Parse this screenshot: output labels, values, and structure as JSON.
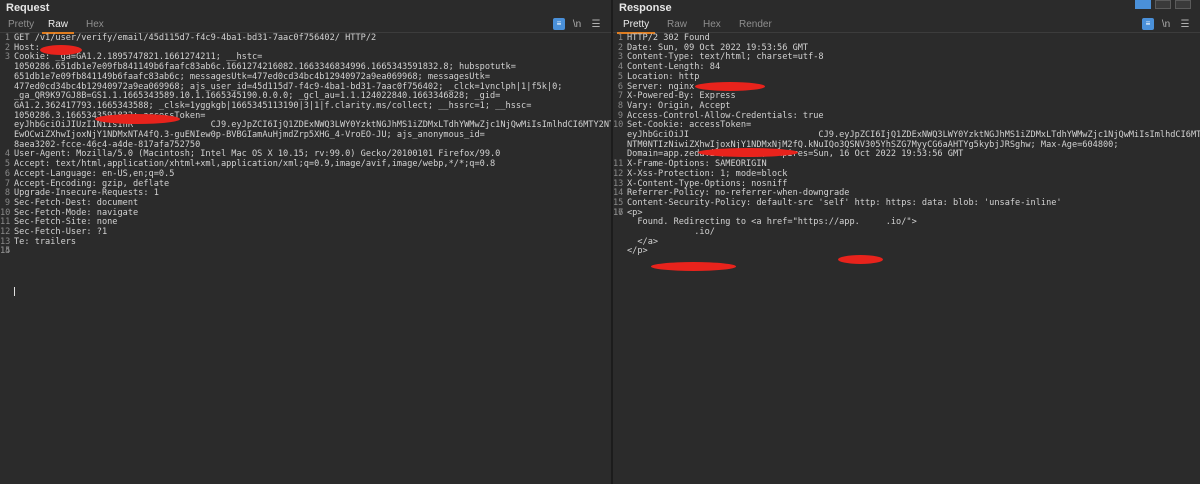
{
  "request": {
    "title": "Request",
    "tabs": [
      "Pretty",
      "Raw",
      "Hex"
    ],
    "active_tab": "Raw",
    "newline_btn": "\\n",
    "lines": [
      {
        "n": "1",
        "text": [
          "GET /v1/user/verify/email/45d115d7-f4c9-4ba1-bd31-7aac0f756402/ HTTP/2"
        ]
      },
      {
        "n": "2",
        "text": [
          "Host: "
        ]
      },
      {
        "n": "3",
        "text": [
          "Cookie: _ga=GA1.2.1895747821.1661274211; __hstc=",
          "1050286.651db1e7e09fb841149b6faafc83ab6c.1661274216082.1663346834996.1665343591832.8; hubspotutk=",
          "651db1e7e09fb841149b6faafc83ab6c; messagesUtk=477ed0cd34bc4b12940972a9ea069968; messagesUtk=",
          "477ed0cd34bc4b12940972a9ea069968; ajs_user_id=45d115d7-f4c9-4ba1-bd31-7aac0f756402; _clck=1vnclph|1|f5k|0;",
          "_ga_QR9K97GJ8B=GS1.1.1665343589.10.1.1665345190.0.0.0; _gcl_au=1.1.124022840.1663346828; _gid=",
          "GA1.2.362417793.1665343588; _clsk=1yggkgb|1665345113190|3|1|f.clarity.ms/collect; __hssrc=1; __hssc=",
          "1050286.3.1665343591832; accessToken=",
          "eyJhbGciOiJIUzI1NiIsInR               CJ9.eyJpZCI6IjQ1ZDExNWQ3LWY0YzktNGJhMS1iZDMxLTdhYWMwZjc1NjQwMiIsImlhdCI6MTY2NTM0NT",
          "EwOCwiZXhwIjoxNjY1NDMxNTA4fQ.3-guENIew0p-BVBGIamAuHjmdZrp5XHG_4-VroEO-JU; ajs_anonymous_id=",
          "8aea3202-fcce-46c4-a4de-817afa752750"
        ]
      },
      {
        "n": "4",
        "text": [
          "User-Agent: Mozilla/5.0 (Macintosh; Intel Mac OS X 10.15; rv:99.0) Gecko/20100101 Firefox/99.0"
        ]
      },
      {
        "n": "5",
        "text": [
          "Accept: text/html,application/xhtml+xml,application/xml;q=0.9,image/avif,image/webp,*/*;q=0.8"
        ]
      },
      {
        "n": "6",
        "text": [
          "Accept-Language: en-US,en;q=0.5"
        ]
      },
      {
        "n": "7",
        "text": [
          "Accept-Encoding: gzip, deflate"
        ]
      },
      {
        "n": "8",
        "text": [
          "Upgrade-Insecure-Requests: 1"
        ]
      },
      {
        "n": "9",
        "text": [
          "Sec-Fetch-Dest: document"
        ]
      },
      {
        "n": "10",
        "text": [
          "Sec-Fetch-Mode: navigate"
        ]
      },
      {
        "n": "11",
        "text": [
          "Sec-Fetch-Site: none"
        ]
      },
      {
        "n": "12",
        "text": [
          "Sec-Fetch-User: ?1"
        ]
      },
      {
        "n": "13",
        "text": [
          "Te: trailers"
        ]
      },
      {
        "n": "14",
        "text": [
          ""
        ]
      },
      {
        "n": "15",
        "text": [
          ""
        ]
      }
    ]
  },
  "response": {
    "title": "Response",
    "tabs": [
      "Pretty",
      "Raw",
      "Hex",
      "Render"
    ],
    "active_tab": "Pretty",
    "newline_btn": "\\n",
    "lines": [
      {
        "n": "1",
        "text": [
          "HTTP/2 302 Found"
        ]
      },
      {
        "n": "2",
        "text": [
          "Date: Sun, 09 Oct 2022 19:53:56 GMT"
        ]
      },
      {
        "n": "3",
        "text": [
          "Content-Type: text/html; charset=utf-8"
        ]
      },
      {
        "n": "4",
        "text": [
          "Content-Length: 84"
        ]
      },
      {
        "n": "5",
        "text": [
          "Location: http"
        ]
      },
      {
        "n": "6",
        "text": [
          "Server: nginx"
        ]
      },
      {
        "n": "7",
        "text": [
          "X-Powered-By: Express"
        ]
      },
      {
        "n": "8",
        "text": [
          "Vary: Origin, Accept"
        ]
      },
      {
        "n": "9",
        "text": [
          "Access-Control-Allow-Credentials: true"
        ]
      },
      {
        "n": "10",
        "text": [
          "Set-Cookie: accessToken=",
          "eyJhbGciOiJI                         CJ9.eyJpZCI6IjQ1ZDExNWQ3LWY0YzktNGJhMS1iZDMxLTdhYWMwZjc1NjQwMiIsImlhdCI6MTY2",
          "NTM0NTIzNiwiZXhwIjoxNjY1NDMxNjM2fQ.kNuIQo3QSNV305YhSZG7MyyCG6aAHTYg5kybjJRSghw; Max-Age=604800;",
          "Domain=app.zeda.io; Path=/; Expires=Sun, 16 Oct 2022 19:53:56 GMT"
        ]
      },
      {
        "n": "11",
        "text": [
          "X-Frame-Options: SAMEORIGIN"
        ]
      },
      {
        "n": "12",
        "text": [
          "X-Xss-Protection: 1; mode=block"
        ]
      },
      {
        "n": "13",
        "text": [
          "X-Content-Type-Options: nosniff"
        ]
      },
      {
        "n": "14",
        "text": [
          "Referrer-Policy: no-referrer-when-downgrade"
        ]
      },
      {
        "n": "15",
        "text": [
          "Content-Security-Policy: default-src 'self' http: https: data: blob: 'unsafe-inline'"
        ]
      },
      {
        "n": "16",
        "text": [
          ""
        ]
      },
      {
        "n": "17",
        "text": [
          "<p>",
          "  Found. Redirecting to <a href=\"https://app.     .io/\">",
          "             .io/",
          "  </a>",
          "</p>"
        ]
      }
    ]
  }
}
